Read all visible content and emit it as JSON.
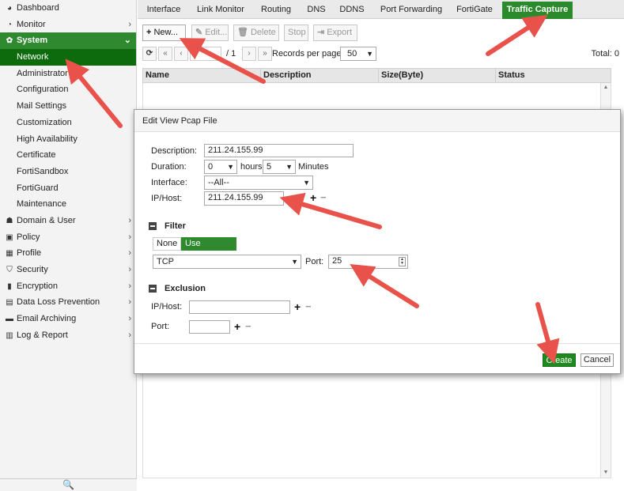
{
  "sidebar": {
    "items": [
      {
        "label": "Dashboard",
        "icon": "dashboard-icon",
        "glyph": "◕",
        "type": "top"
      },
      {
        "label": "Monitor",
        "icon": "monitor-icon",
        "glyph": "◔",
        "type": "top",
        "chevron": "›"
      },
      {
        "label": "System",
        "icon": "gear-icon",
        "glyph": "✿",
        "type": "section",
        "chevron": "⌄"
      },
      {
        "label": "Network",
        "type": "sub",
        "active": true
      },
      {
        "label": "Administrator",
        "type": "sub"
      },
      {
        "label": "Configuration",
        "type": "sub"
      },
      {
        "label": "Mail Settings",
        "type": "sub"
      },
      {
        "label": "Customization",
        "type": "sub"
      },
      {
        "label": "High Availability",
        "type": "sub"
      },
      {
        "label": "Certificate",
        "type": "sub"
      },
      {
        "label": "FortiSandbox",
        "type": "sub"
      },
      {
        "label": "FortiGuard",
        "type": "sub"
      },
      {
        "label": "Maintenance",
        "type": "sub"
      },
      {
        "label": "Domain & User",
        "icon": "user-icon",
        "glyph": "☗",
        "type": "top",
        "chevron": "›"
      },
      {
        "label": "Policy",
        "icon": "policy-icon",
        "glyph": "▣",
        "type": "top",
        "chevron": "›"
      },
      {
        "label": "Profile",
        "icon": "profile-icon",
        "glyph": "▦",
        "type": "top",
        "chevron": "›"
      },
      {
        "label": "Security",
        "icon": "shield-icon",
        "glyph": "⛉",
        "type": "top",
        "chevron": "›"
      },
      {
        "label": "Encryption",
        "icon": "lock-icon",
        "glyph": "▮",
        "type": "top",
        "chevron": "›"
      },
      {
        "label": "Data Loss Prevention",
        "icon": "dlp-icon",
        "glyph": "▤",
        "type": "top",
        "chevron": "›"
      },
      {
        "label": "Email Archiving",
        "icon": "archive-icon",
        "glyph": "▬",
        "type": "top",
        "chevron": "›"
      },
      {
        "label": "Log & Report",
        "icon": "report-icon",
        "glyph": "▥",
        "type": "top",
        "chevron": "›"
      }
    ],
    "search_glyph": "🔍"
  },
  "tabs": [
    {
      "label": "Interface"
    },
    {
      "label": "Link Monitor"
    },
    {
      "label": "Routing"
    },
    {
      "label": "DNS"
    },
    {
      "label": "DDNS"
    },
    {
      "label": "Port Forwarding"
    },
    {
      "label": "FortiGate"
    },
    {
      "label": "Traffic Capture",
      "active": true
    }
  ],
  "toolbar": {
    "new": "New...",
    "new_glyph": "+",
    "edit": "Edit...",
    "edit_glyph": "✎",
    "delete": "Delete",
    "delete_glyph": "🗑",
    "stop": "Stop",
    "export": "Export",
    "export_glyph": "⇥"
  },
  "pager": {
    "refresh_glyph": "⟳",
    "first_glyph": "«",
    "prev_glyph": "‹",
    "next_glyph": "›",
    "last_glyph": "»",
    "page_total": "/ 1",
    "records_per_page_label": "Records per page:",
    "records_per_page": "50",
    "total": "Total: 0"
  },
  "grid": {
    "columns": [
      "Name",
      "Description",
      "Size(Byte)",
      "Status"
    ]
  },
  "dialog": {
    "title": "Edit View Pcap File",
    "description_label": "Description:",
    "description_value": "211.24.155.99",
    "duration_label": "Duration:",
    "duration_hours": "0",
    "hours_label": "hours",
    "duration_minutes": "5",
    "minutes_label": "Minutes",
    "interface_label": "Interface:",
    "interface_value": "--All--",
    "iphost_label": "IP/Host:",
    "iphost_value": "211.24.155.99",
    "filter_title": "Filter",
    "filter_none": "None",
    "filter_use_protocol": "Use protocol",
    "protocol_value": "TCP",
    "port_label": "Port:",
    "port_value": "25",
    "exclusion_title": "Exclusion",
    "excl_iphost_label": "IP/Host:",
    "excl_port_label": "Port:",
    "create": "Create",
    "cancel": "Cancel"
  },
  "colors": {
    "accent_green": "#2f8a2f",
    "annotation_red": "#e8524a"
  }
}
